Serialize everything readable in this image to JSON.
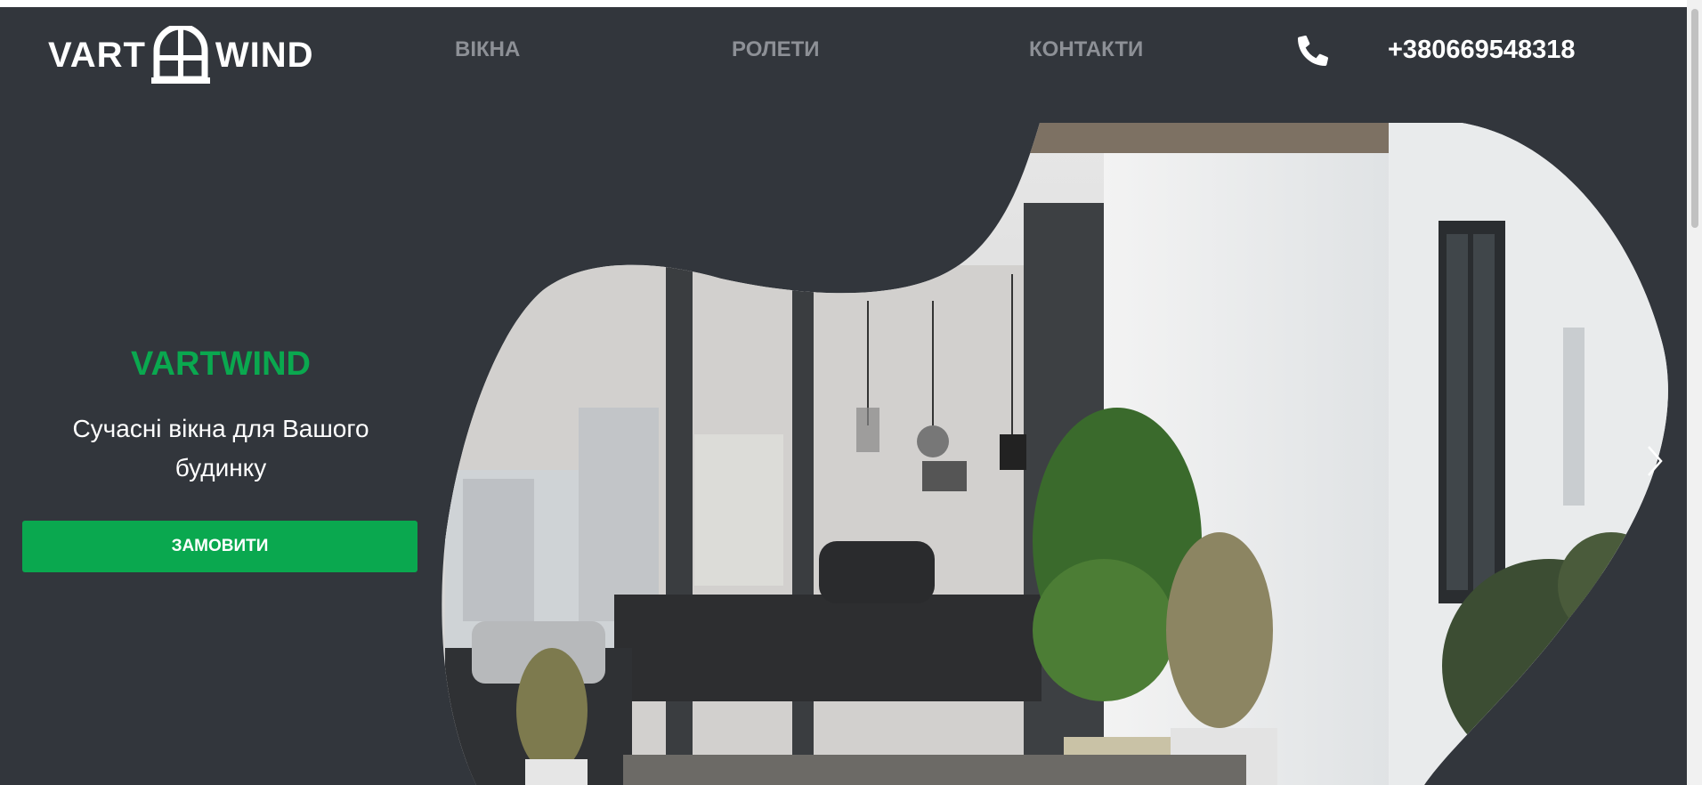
{
  "header": {
    "logo_left": "VART",
    "logo_right": "WIND",
    "nav": [
      "ВІКНА",
      "РОЛЕТИ",
      "КОНТАКТИ"
    ],
    "phone_icon": "phone-icon",
    "phone": "+380669548318"
  },
  "hero": {
    "title": "VARTWIND",
    "subtitle_line1": "Сучасні вікна для Вашого",
    "subtitle_line2": "будинку",
    "button": "ЗАМОВИТИ",
    "next_icon": "chevron-right-icon"
  },
  "colors": {
    "background": "#32363c",
    "accent": "#0aa84f",
    "nav_text": "#8d9096",
    "text": "#ffffff"
  }
}
